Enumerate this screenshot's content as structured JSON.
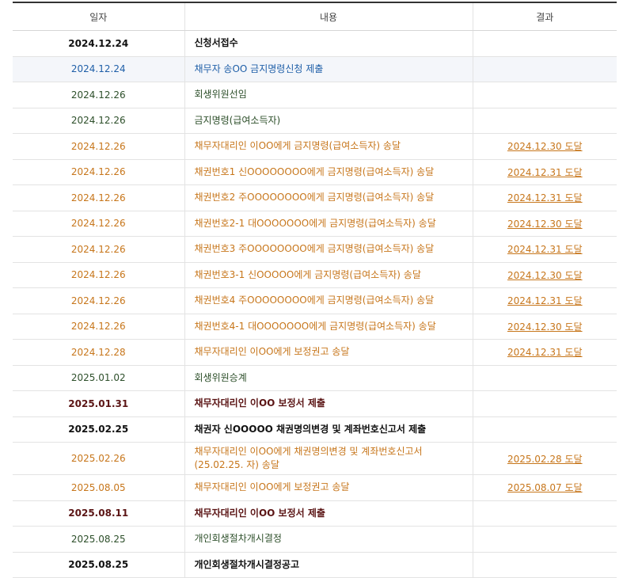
{
  "headers": {
    "date": "일자",
    "content": "내용",
    "result": "결과"
  },
  "rows": [
    {
      "date": "2024.12.24",
      "content": "신청서접수",
      "result": "",
      "style": "c-black",
      "hl": false
    },
    {
      "date": "2024.12.24",
      "content": "채무자 송OO 금지명령신청 제출",
      "result": "",
      "style": "c-blue",
      "hl": true
    },
    {
      "date": "2024.12.26",
      "content": "회생위원선임",
      "result": "",
      "style": "c-green",
      "hl": false
    },
    {
      "date": "2024.12.26",
      "content": "금지명령(급여소득자)",
      "result": "",
      "style": "c-green",
      "hl": false
    },
    {
      "date": "2024.12.26",
      "content": "채무자대리인 이OO에게 금지명령(급여소득자) 송달",
      "result": "2024.12.30 도달",
      "style": "c-orange",
      "hl": false
    },
    {
      "date": "2024.12.26",
      "content": "채권번호1 신OOOOOOOO에게 금지명령(급여소득자) 송달",
      "result": "2024.12.31 도달",
      "style": "c-orange",
      "hl": false
    },
    {
      "date": "2024.12.26",
      "content": "채권번호2 주OOOOOOOO에게 금지명령(급여소득자) 송달",
      "result": "2024.12.31 도달",
      "style": "c-orange",
      "hl": false
    },
    {
      "date": "2024.12.26",
      "content": "채권번호2-1 대OOOOOOO에게 금지명령(급여소득자) 송달",
      "result": "2024.12.30 도달",
      "style": "c-orange",
      "hl": false
    },
    {
      "date": "2024.12.26",
      "content": "채권번호3 주OOOOOOOO에게 금지명령(급여소득자) 송달",
      "result": "2024.12.31 도달",
      "style": "c-orange",
      "hl": false
    },
    {
      "date": "2024.12.26",
      "content": "채권번호3-1 신OOOOO에게 금지명령(급여소득자) 송달",
      "result": "2024.12.30 도달",
      "style": "c-orange",
      "hl": false
    },
    {
      "date": "2024.12.26",
      "content": "채권번호4 주OOOOOOOO에게 금지명령(급여소득자) 송달",
      "result": "2024.12.31 도달",
      "style": "c-orange",
      "hl": false
    },
    {
      "date": "2024.12.26",
      "content": "채권번호4-1 대OOOOOOO에게 금지명령(급여소득자) 송달",
      "result": "2024.12.30 도달",
      "style": "c-orange",
      "hl": false
    },
    {
      "date": "2024.12.28",
      "content": "채무자대리인 이OO에게 보정권고 송달",
      "result": "2024.12.31 도달",
      "style": "c-orange",
      "hl": false
    },
    {
      "date": "2025.01.02",
      "content": "회생위원승계",
      "result": "",
      "style": "c-green",
      "hl": false
    },
    {
      "date": "2025.01.31",
      "content": "채무자대리인 이OO 보정서 제출",
      "result": "",
      "style": "c-maroon",
      "hl": false
    },
    {
      "date": "2025.02.25",
      "content": "채권자 신OOOOO 채권명의변경 및 계좌번호신고서 제출",
      "result": "",
      "style": "c-black",
      "hl": false
    },
    {
      "date": "2025.02.26",
      "content": "채무자대리인 이OO에게 채권명의변경 및 계좌번호신고서(25.02.25. 자) 송달",
      "result": "2025.02.28 도달",
      "style": "c-orange",
      "hl": false,
      "tall": true
    },
    {
      "date": "2025.08.05",
      "content": "채무자대리인 이OO에게 보정권고 송달",
      "result": "2025.08.07 도달",
      "style": "c-orange",
      "hl": false
    },
    {
      "date": "2025.08.11",
      "content": "채무자대리인 이OO 보정서 제출",
      "result": "",
      "style": "c-maroon",
      "hl": false
    },
    {
      "date": "2025.08.25",
      "content": "개인회생절차개시결정",
      "result": "",
      "style": "c-green",
      "hl": false
    },
    {
      "date": "2025.08.25",
      "content": "개인회생절차개시결정공고",
      "result": "",
      "style": "c-black",
      "hl": false
    }
  ]
}
